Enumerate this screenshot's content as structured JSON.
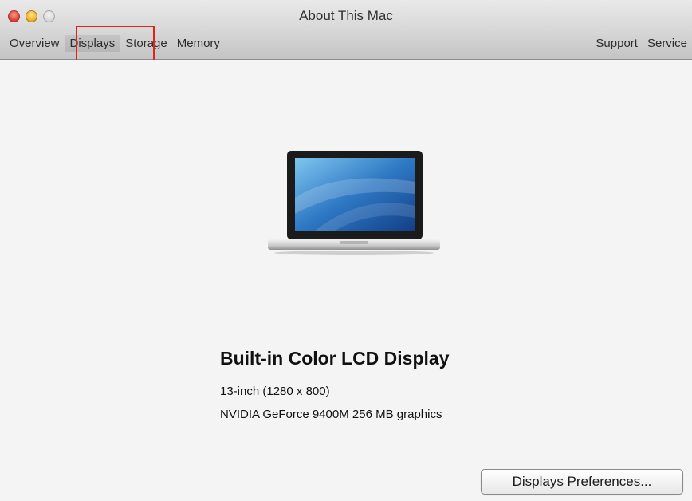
{
  "window": {
    "title": "About This Mac"
  },
  "tabs": [
    {
      "label": "Overview",
      "selected": false
    },
    {
      "label": "Displays",
      "selected": true
    },
    {
      "label": "Storage",
      "selected": false
    },
    {
      "label": "Memory",
      "selected": false
    }
  ],
  "right_tabs": [
    {
      "label": "Support"
    },
    {
      "label": "Service"
    }
  ],
  "display": {
    "name": "Built-in Color LCD Display",
    "size": "13-inch (1280 x 800)",
    "graphics": "NVIDIA GeForce 9400M 256 MB graphics"
  },
  "buttons": {
    "preferences": "Displays Preferences..."
  },
  "colors": {
    "highlight": "#e0221c",
    "close": "#e0443a",
    "minimize": "#f2b52f"
  },
  "icons": [
    "close-icon",
    "minimize-icon",
    "zoom-icon",
    "laptop-icon"
  ]
}
